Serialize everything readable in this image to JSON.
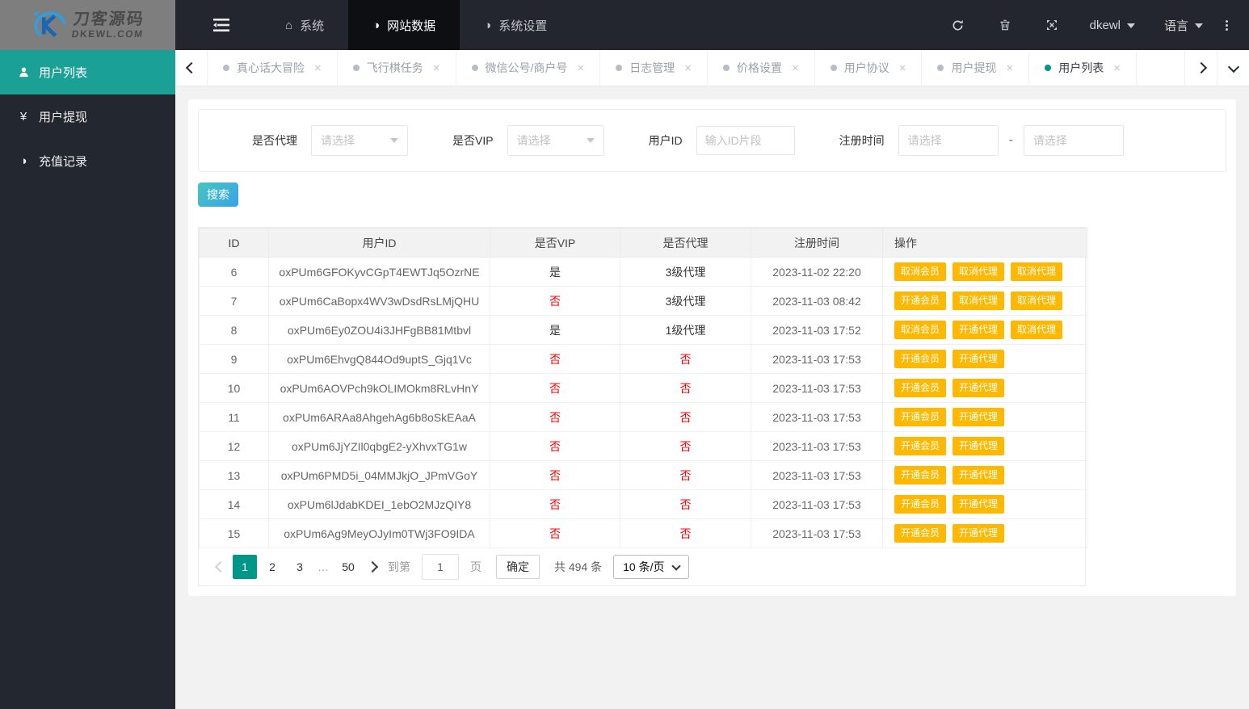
{
  "brand": {
    "title": "刀客源码",
    "subtitle": "DKEWL.COM"
  },
  "navbar": {
    "items": [
      {
        "label": "系统",
        "icon": "home-icon",
        "active": false
      },
      {
        "label": "网站数据",
        "icon": "half-circle-icon",
        "active": true
      },
      {
        "label": "系统设置",
        "icon": "half-circle-icon",
        "active": false
      }
    ],
    "right": {
      "username": "dkewl",
      "language_label": "语言"
    }
  },
  "sidebar": {
    "items": [
      {
        "label": "用户列表",
        "icon": "user-icon",
        "active": true
      },
      {
        "label": "用户提现",
        "icon": "yen-icon",
        "active": false
      },
      {
        "label": "充值记录",
        "icon": "half-circle-icon",
        "active": false
      }
    ]
  },
  "tabs": {
    "items": [
      {
        "label": "真心话大冒险",
        "active": false
      },
      {
        "label": "飞行棋任务",
        "active": false
      },
      {
        "label": "微信公号/商户号",
        "active": false
      },
      {
        "label": "日志管理",
        "active": false
      },
      {
        "label": "价格设置",
        "active": false
      },
      {
        "label": "用户协议",
        "active": false
      },
      {
        "label": "用户提现",
        "active": false
      },
      {
        "label": "用户列表",
        "active": true
      }
    ],
    "close_glyph": "×"
  },
  "filters": {
    "agent": {
      "label": "是否代理",
      "placeholder": "请选择"
    },
    "vip": {
      "label": "是否VIP",
      "placeholder": "请选择"
    },
    "user_id": {
      "label": "用户ID",
      "placeholder": "输入ID片段"
    },
    "reg_time": {
      "label": "注册时间",
      "placeholder_start": "请选择",
      "placeholder_end": "请选择",
      "separator": "-"
    }
  },
  "search_button": "搜索",
  "table": {
    "headers": [
      "ID",
      "用户ID",
      "是否VIP",
      "是否代理",
      "注册时间",
      "操作"
    ],
    "negative_value": "否",
    "rows": [
      {
        "id": "6",
        "user_id": "oxPUm6GFOKyvCGpT4EWTJq5OzrNE",
        "vip": "是",
        "agent": "3级代理",
        "reg_time": "2023-11-02 22:20",
        "actions": [
          "取消会员",
          "取消代理",
          "取消代理"
        ]
      },
      {
        "id": "7",
        "user_id": "oxPUm6CaBopx4WV3wDsdRsLMjQHU",
        "vip": "否",
        "agent": "3级代理",
        "reg_time": "2023-11-03 08:42",
        "actions": [
          "开通会员",
          "取消代理",
          "取消代理"
        ]
      },
      {
        "id": "8",
        "user_id": "oxPUm6Ey0ZOU4i3JHFgBB81Mtbvl",
        "vip": "是",
        "agent": "1级代理",
        "reg_time": "2023-11-03 17:52",
        "actions": [
          "取消会员",
          "开通代理",
          "取消代理"
        ]
      },
      {
        "id": "9",
        "user_id": "oxPUm6EhvgQ844Od9uptS_Gjq1Vc",
        "vip": "否",
        "agent": "否",
        "reg_time": "2023-11-03 17:53",
        "actions": [
          "开通会员",
          "开通代理"
        ]
      },
      {
        "id": "10",
        "user_id": "oxPUm6AOVPch9kOLIMOkm8RLvHnY",
        "vip": "否",
        "agent": "否",
        "reg_time": "2023-11-03 17:53",
        "actions": [
          "开通会员",
          "开通代理"
        ]
      },
      {
        "id": "11",
        "user_id": "oxPUm6ARAa8AhgehAg6b8oSkEAaA",
        "vip": "否",
        "agent": "否",
        "reg_time": "2023-11-03 17:53",
        "actions": [
          "开通会员",
          "开通代理"
        ]
      },
      {
        "id": "12",
        "user_id": "oxPUm6JjYZIl0qbgE2-yXhvxTG1w",
        "vip": "否",
        "agent": "否",
        "reg_time": "2023-11-03 17:53",
        "actions": [
          "开通会员",
          "开通代理"
        ]
      },
      {
        "id": "13",
        "user_id": "oxPUm6PMD5i_04MMJkjO_JPmVGoY",
        "vip": "否",
        "agent": "否",
        "reg_time": "2023-11-03 17:53",
        "actions": [
          "开通会员",
          "开通代理"
        ]
      },
      {
        "id": "14",
        "user_id": "oxPUm6lJdabKDEI_1ebO2MJzQIY8",
        "vip": "否",
        "agent": "否",
        "reg_time": "2023-11-03 17:53",
        "actions": [
          "开通会员",
          "开通代理"
        ]
      },
      {
        "id": "15",
        "user_id": "oxPUm6Ag9MeyOJyIm0TWj3FO9IDA",
        "vip": "否",
        "agent": "否",
        "reg_time": "2023-11-03 17:53",
        "actions": [
          "开通会员",
          "开通代理"
        ]
      }
    ]
  },
  "pagination": {
    "pages": [
      "1",
      "2",
      "3",
      "…",
      "50"
    ],
    "active_page": "1",
    "goto_label": "到第",
    "goto_value": "1",
    "page_label": "页",
    "confirm_label": "确定",
    "total_label": "共 494 条",
    "per_page_label": "10 条/页"
  },
  "colors": {
    "teal": "#1aa094",
    "page_active": "#009688",
    "action": "#ffb800",
    "negative": "#ff0000",
    "search_from": "#47c5bf",
    "search_to": "#37a3e9"
  }
}
